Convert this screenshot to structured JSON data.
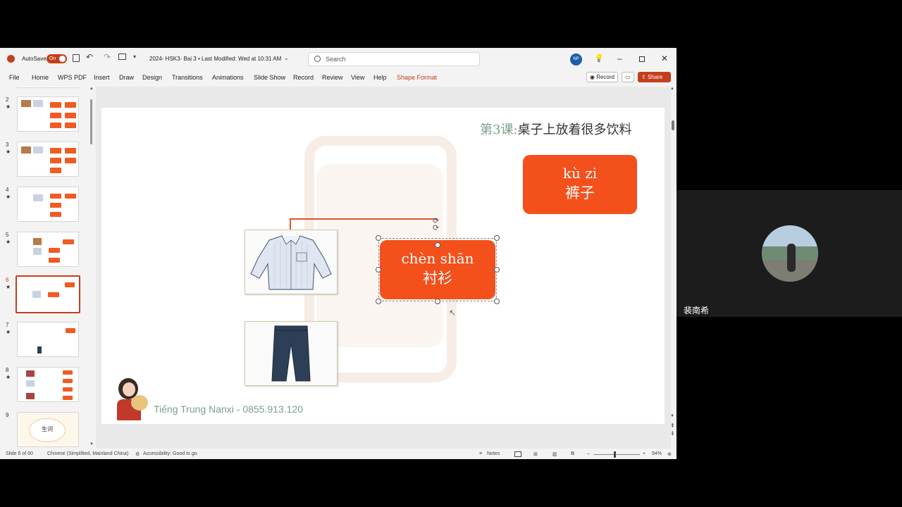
{
  "titlebar": {
    "autosave_label": "AutoSave",
    "autosave_state": "On",
    "doc_title": "2024- HSK3- Bai 3",
    "modified": "• Last Modified: Wed at 10:31 AM",
    "search_placeholder": "Search",
    "user_initials": "NP"
  },
  "ribbon": {
    "tabs": [
      "File",
      "Home",
      "WPS PDF",
      "Insert",
      "Draw",
      "Design",
      "Transitions",
      "Animations",
      "Slide Show",
      "Record",
      "Review",
      "View",
      "Help",
      "Shape Format"
    ],
    "record_button": "Record",
    "share_button": "Share"
  },
  "thumbnails": {
    "numbers": [
      "2",
      "3",
      "4",
      "5",
      "6",
      "7",
      "8",
      "9"
    ],
    "slide9_text": "生词"
  },
  "slide": {
    "lesson_prefix": "第3课:",
    "lesson_title": "桌子上放着很多饮料",
    "card_kuzi_pinyin": "kù zi",
    "card_kuzi_hanzi": "裤子",
    "card_chenshan_pinyin": "chèn shān",
    "card_chenshan_hanzi": "衬衫",
    "footer": "Tiếng Trung Nanxi - 0855.913.120"
  },
  "status": {
    "slide_count": "Slide 6 of 60",
    "language": "Chinese (Simplified, Mainland China)",
    "accessibility": "Accessibility: Good to go",
    "notes": "Notes",
    "zoom": "94%"
  },
  "video": {
    "participant_name": "裴南希"
  },
  "colors": {
    "accent": "#c43e1c",
    "card": "#f3501c",
    "green_text": "#7aa08a"
  }
}
